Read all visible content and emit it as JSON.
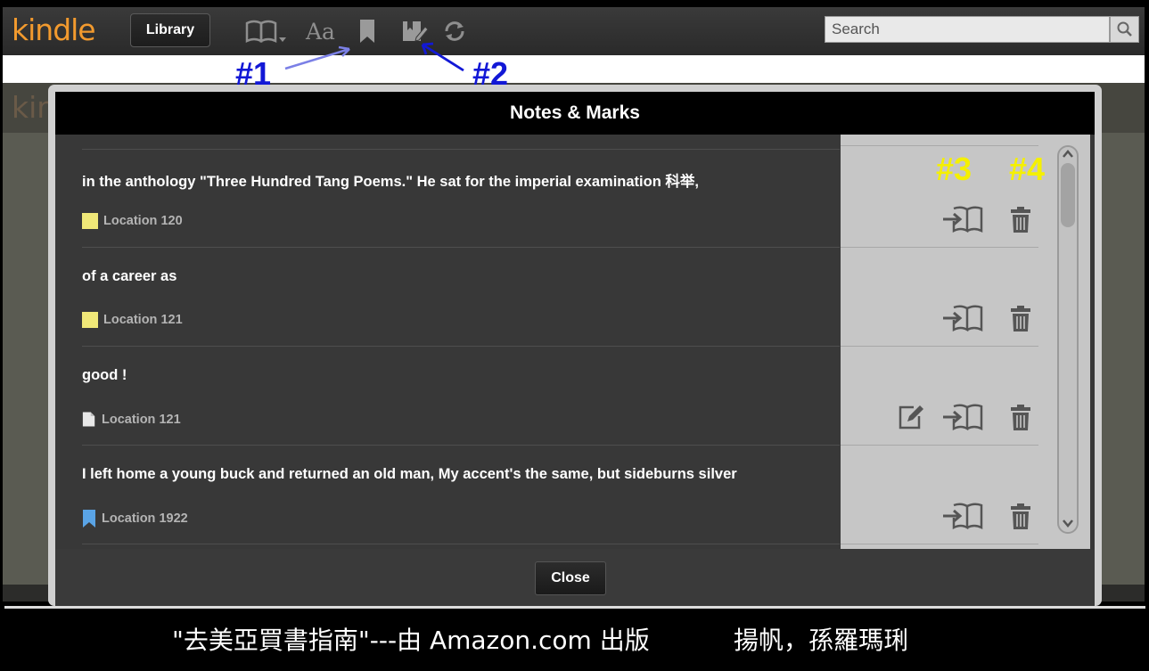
{
  "toolbar": {
    "logo": "kindle",
    "library_label": "Library",
    "icons": [
      "book-view-icon",
      "font-settings-icon",
      "bookmark-icon",
      "notes-marks-icon",
      "sync-icon"
    ],
    "search_placeholder": "Search",
    "colors": {
      "logo": "#f29a2e",
      "toolbar": "#333333"
    }
  },
  "annotations": {
    "a1": "#1",
    "a2": "#2",
    "a3": "#3",
    "a4": "#4"
  },
  "dialog": {
    "title": "Notes & Marks",
    "items": [
      {
        "text": "in the anthology \"Three Hundred Tang Poems.\" He sat for the imperial examination 科举,",
        "location": "Location 120",
        "type": "highlight",
        "marker_color": "#f0e878",
        "actions": [
          "go-to-location-icon",
          "delete-icon"
        ]
      },
      {
        "text": "of a career as",
        "location": "Location 121",
        "type": "highlight",
        "marker_color": "#f0e878",
        "actions": [
          "go-to-location-icon",
          "delete-icon"
        ]
      },
      {
        "text": "good !",
        "location": "Location 121",
        "type": "note",
        "marker_color": "#e8e8e8",
        "actions": [
          "edit-note-icon",
          "go-to-location-icon",
          "delete-icon"
        ]
      },
      {
        "text": "I left home a young buck and returned an old man, My accent's the same, but sideburns silver",
        "location": "Location 1922",
        "type": "bookmark",
        "marker_color": "#5aa4e6",
        "actions": [
          "go-to-location-icon",
          "delete-icon"
        ]
      }
    ],
    "close_label": "Close"
  },
  "caption": {
    "left": "\"去美亞買書指南\"---由 Amazon.com 出版",
    "right": "揚帆，孫羅瑪琍"
  }
}
